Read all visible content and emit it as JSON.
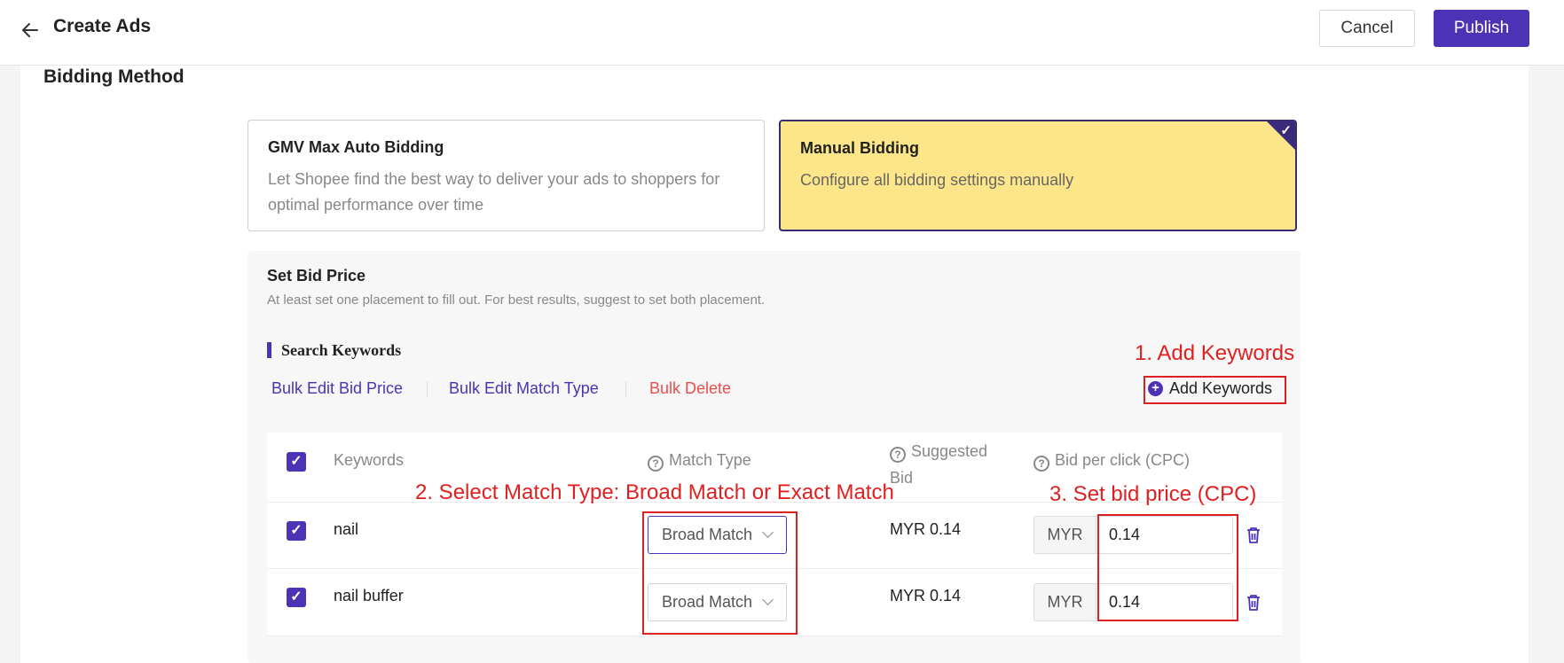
{
  "header": {
    "title": "Create Ads",
    "cancel_label": "Cancel",
    "publish_label": "Publish"
  },
  "bidding": {
    "section_title": "Bidding Method",
    "options": [
      {
        "title": "GMV Max Auto Bidding",
        "description": "Let Shopee find the best way to deliver your ads to shoppers for optimal performance over time",
        "selected": false
      },
      {
        "title": "Manual Bidding",
        "description": "Configure all bidding settings manually",
        "selected": true
      }
    ]
  },
  "bid_price": {
    "title": "Set Bid Price",
    "subtitle": "At least set one placement to fill out. For best results, suggest to set both placement."
  },
  "keywords": {
    "title": "Search Keywords",
    "bulk_edit_bid": "Bulk Edit Bid Price",
    "bulk_edit_match": "Bulk Edit Match Type",
    "bulk_delete": "Bulk Delete",
    "add_keywords": "Add Keywords",
    "columns": {
      "keywords": "Keywords",
      "match_type": "Match Type",
      "suggested_bid": "Suggested Bid",
      "bid_per_click": "Bid per click (CPC)"
    },
    "rows": [
      {
        "keyword": "nail",
        "match_type": "Broad Match",
        "suggested": "MYR 0.14",
        "currency": "MYR",
        "bid": "0.14",
        "checked": true
      },
      {
        "keyword": "nail buffer",
        "match_type": "Broad Match",
        "suggested": "MYR 0.14",
        "currency": "MYR",
        "bid": "0.14",
        "checked": true
      }
    ]
  },
  "annotations": {
    "step1": "1. Add Keywords",
    "step2": "2. Select Match Type: Broad Match or Exact Match",
    "step3": "3. Set bid price (CPC)"
  },
  "colors": {
    "accent": "#4c33b5",
    "selected_card": "#fde589",
    "danger": "#ee4d4d",
    "annotation": "#e02020"
  }
}
